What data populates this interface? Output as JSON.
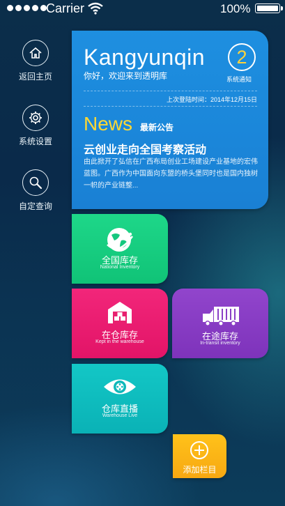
{
  "status_bar": {
    "carrier": "Carrier",
    "battery_percent": "100%",
    "signal_dots": 5
  },
  "sidebar": {
    "items": [
      {
        "label": "返回主页",
        "icon": "home-icon"
      },
      {
        "label": "系统设置",
        "icon": "gear-icon"
      },
      {
        "label": "自定查询",
        "icon": "search-icon"
      }
    ]
  },
  "main_card": {
    "brand": "Kangyunqin",
    "welcome": "你好，欢迎来到透明库",
    "notification_count": "2",
    "notification_label": "系统通知",
    "last_login": "上次登陆时间：2014年12月15日",
    "news_word": "News",
    "news_subtitle": "最新公告",
    "headline": "云创业走向全国考察活动",
    "summary": "由此掀开了弘信在广西布局创业工场建设产业基地的宏伟蓝图。广西作为中国面向东盟的桥头堡同时也是国内独树一帜的产业链整...",
    "color": "#1e8fe0"
  },
  "tiles": [
    {
      "cn": "全国库存",
      "en": "National Inventory",
      "icon": "globe-icon",
      "color": "#1ed789"
    },
    {
      "cn": "在仓库存",
      "en": "Kept in the warehouse",
      "icon": "warehouse-icon",
      "color": "#f2267a"
    },
    {
      "cn": "在途库存",
      "en": "In-transit inventory",
      "icon": "truck-icon",
      "color": "#9145cc"
    },
    {
      "cn": "仓库直播",
      "en": "Warehouse Live",
      "icon": "eye-camera-icon",
      "color": "#13c7c6"
    }
  ],
  "add_tile": {
    "label": "添加栏目",
    "icon": "plus-circle-icon",
    "color": "#ffc21a"
  }
}
